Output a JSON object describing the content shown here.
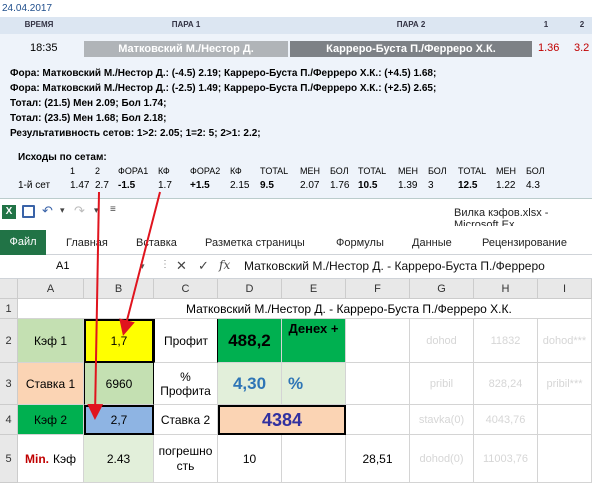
{
  "web": {
    "date": "24.04.2017",
    "headers": {
      "time": "ВРЕМЯ",
      "pair1": "ПАРА 1",
      "pair2": "ПАРА 2",
      "col1": "1",
      "col2": "2"
    },
    "match": {
      "time": "18:35",
      "player1": "Матковский М./Нестор Д.",
      "player2": "Карреро-Буста П./Ферреро Х.К.",
      "odd1": "1.36",
      "odd2": "3.2"
    },
    "lines": [
      "Фора: Матковский М./Нестор Д.: (-4.5) 2.19; Карреро-Буста П./Ферреро Х.К.: (+4.5) 1.68;",
      "Фора: Матковский М./Нестор Д.: (-2.5) 1.49; Карреро-Буста П./Ферреро Х.К.: (+2.5) 2.65;",
      "Тотал: (21.5) Мен 2.09; Бол 1.74;",
      "Тотал: (23.5) Мен 1.68; Бол 2.18;",
      "Результативность сетов: 1>2: 2.05; 1=2: 5; 2>1: 2.2;"
    ],
    "sets_title": "Исходы по сетам:",
    "sets_header": [
      "1",
      "2",
      "ФОРА1",
      "КФ",
      "ФОРА2",
      "КФ",
      "TOTAL",
      "МЕН",
      "БОЛ",
      "TOTAL",
      "МЕН",
      "БОЛ",
      "TOTAL",
      "МЕН",
      "БОЛ"
    ],
    "sets_row_label": "1-й сет",
    "sets_row": [
      "1.47",
      "2.7",
      "-1.5",
      "1.7",
      "+1.5",
      "2.15",
      "9.5",
      "2.07",
      "1.76",
      "10.5",
      "1.39",
      "3",
      "12.5",
      "1.22",
      "4.3"
    ]
  },
  "excel": {
    "title": "Вилка кэфов.xlsx - Microsoft Ex",
    "tabs": [
      "Файл",
      "Главная",
      "Вставка",
      "Разметка страницы",
      "Формулы",
      "Данные",
      "Рецензирование"
    ],
    "name_box": "A1",
    "fx": "fx",
    "formula": "Матковский М./Нестор Д. - Карреро-Буста П./Ферреро",
    "columns": [
      "A",
      "B",
      "C",
      "D",
      "E",
      "F",
      "G",
      "H",
      "I"
    ],
    "rows": [
      "1",
      "2",
      "3",
      "4",
      "5"
    ],
    "row1_text": "Матковский М./Нестор Д. - Карреро-Буста П./Ферреро Х.К.",
    "a2": "Кэф 1",
    "b2": "1,7",
    "c2": "Профит",
    "d2": "488,2",
    "e2": "Денех +",
    "g2": "dohod",
    "h2": "11832",
    "i2": "dohod***",
    "a3": "Ставка 1",
    "b3": "6960",
    "c3": "% Профита",
    "d3": "4,30",
    "e3": "%",
    "g3": "pribil",
    "h3": "828,24",
    "i3": "pribil***",
    "a4": "Кэф 2",
    "b4": "2,7",
    "c4": "Ставка 2",
    "d4": "4384",
    "g4": "stavka(0)",
    "h4": "4043,76",
    "a5_red": "Min.",
    "a5": "Кэф",
    "b5": "2.43",
    "c5": "погрешность",
    "d5": "10",
    "f5": "28,51",
    "g5": "dohod(0)",
    "h5": "11003,76"
  }
}
